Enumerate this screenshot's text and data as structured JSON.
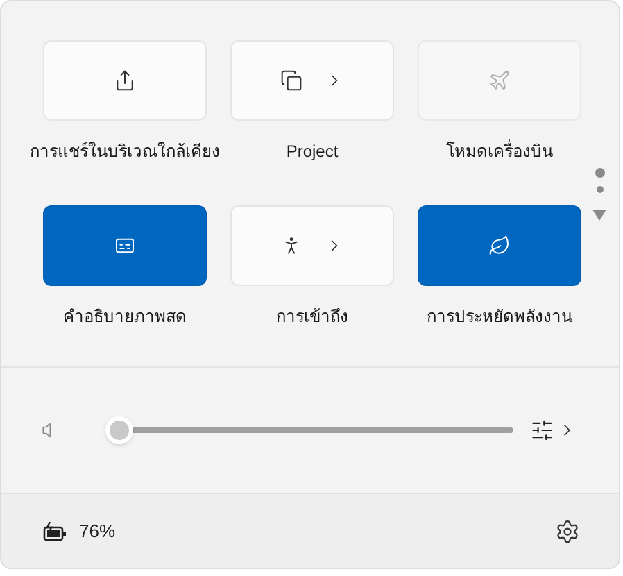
{
  "tiles": [
    {
      "label": "การแชร์ในบริเวณใกล้เคียง",
      "on": false,
      "disabled": false,
      "has_menu": false
    },
    {
      "label": "Project",
      "on": false,
      "disabled": false,
      "has_menu": true
    },
    {
      "label": "โหมดเครื่องบิน",
      "on": false,
      "disabled": true,
      "has_menu": false
    },
    {
      "label": "คำอธิบายภาพสด",
      "on": true,
      "disabled": false,
      "has_menu": false
    },
    {
      "label": "การเข้าถึง",
      "on": false,
      "disabled": false,
      "has_menu": true
    },
    {
      "label": "การประหยัดพลังงาน",
      "on": true,
      "disabled": false,
      "has_menu": false
    }
  ],
  "pages": [
    {
      "selected": true
    },
    {
      "selected": false
    }
  ],
  "volume": {
    "level": 0
  },
  "battery": {
    "reading": "76%"
  }
}
